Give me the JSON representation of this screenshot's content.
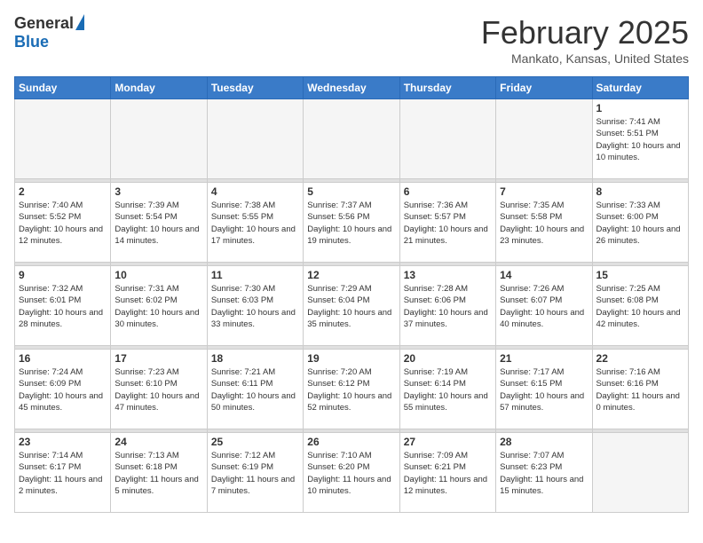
{
  "header": {
    "logo_general": "General",
    "logo_blue": "Blue",
    "month_title": "February 2025",
    "location": "Mankato, Kansas, United States"
  },
  "days_of_week": [
    "Sunday",
    "Monday",
    "Tuesday",
    "Wednesday",
    "Thursday",
    "Friday",
    "Saturday"
  ],
  "weeks": [
    [
      {
        "day": "",
        "empty": true
      },
      {
        "day": "",
        "empty": true
      },
      {
        "day": "",
        "empty": true
      },
      {
        "day": "",
        "empty": true
      },
      {
        "day": "",
        "empty": true
      },
      {
        "day": "",
        "empty": true
      },
      {
        "day": "1",
        "sunrise": "Sunrise: 7:41 AM",
        "sunset": "Sunset: 5:51 PM",
        "daylight": "Daylight: 10 hours and 10 minutes."
      }
    ],
    [
      {
        "day": "2",
        "sunrise": "Sunrise: 7:40 AM",
        "sunset": "Sunset: 5:52 PM",
        "daylight": "Daylight: 10 hours and 12 minutes."
      },
      {
        "day": "3",
        "sunrise": "Sunrise: 7:39 AM",
        "sunset": "Sunset: 5:54 PM",
        "daylight": "Daylight: 10 hours and 14 minutes."
      },
      {
        "day": "4",
        "sunrise": "Sunrise: 7:38 AM",
        "sunset": "Sunset: 5:55 PM",
        "daylight": "Daylight: 10 hours and 17 minutes."
      },
      {
        "day": "5",
        "sunrise": "Sunrise: 7:37 AM",
        "sunset": "Sunset: 5:56 PM",
        "daylight": "Daylight: 10 hours and 19 minutes."
      },
      {
        "day": "6",
        "sunrise": "Sunrise: 7:36 AM",
        "sunset": "Sunset: 5:57 PM",
        "daylight": "Daylight: 10 hours and 21 minutes."
      },
      {
        "day": "7",
        "sunrise": "Sunrise: 7:35 AM",
        "sunset": "Sunset: 5:58 PM",
        "daylight": "Daylight: 10 hours and 23 minutes."
      },
      {
        "day": "8",
        "sunrise": "Sunrise: 7:33 AM",
        "sunset": "Sunset: 6:00 PM",
        "daylight": "Daylight: 10 hours and 26 minutes."
      }
    ],
    [
      {
        "day": "9",
        "sunrise": "Sunrise: 7:32 AM",
        "sunset": "Sunset: 6:01 PM",
        "daylight": "Daylight: 10 hours and 28 minutes."
      },
      {
        "day": "10",
        "sunrise": "Sunrise: 7:31 AM",
        "sunset": "Sunset: 6:02 PM",
        "daylight": "Daylight: 10 hours and 30 minutes."
      },
      {
        "day": "11",
        "sunrise": "Sunrise: 7:30 AM",
        "sunset": "Sunset: 6:03 PM",
        "daylight": "Daylight: 10 hours and 33 minutes."
      },
      {
        "day": "12",
        "sunrise": "Sunrise: 7:29 AM",
        "sunset": "Sunset: 6:04 PM",
        "daylight": "Daylight: 10 hours and 35 minutes."
      },
      {
        "day": "13",
        "sunrise": "Sunrise: 7:28 AM",
        "sunset": "Sunset: 6:06 PM",
        "daylight": "Daylight: 10 hours and 37 minutes."
      },
      {
        "day": "14",
        "sunrise": "Sunrise: 7:26 AM",
        "sunset": "Sunset: 6:07 PM",
        "daylight": "Daylight: 10 hours and 40 minutes."
      },
      {
        "day": "15",
        "sunrise": "Sunrise: 7:25 AM",
        "sunset": "Sunset: 6:08 PM",
        "daylight": "Daylight: 10 hours and 42 minutes."
      }
    ],
    [
      {
        "day": "16",
        "sunrise": "Sunrise: 7:24 AM",
        "sunset": "Sunset: 6:09 PM",
        "daylight": "Daylight: 10 hours and 45 minutes."
      },
      {
        "day": "17",
        "sunrise": "Sunrise: 7:23 AM",
        "sunset": "Sunset: 6:10 PM",
        "daylight": "Daylight: 10 hours and 47 minutes."
      },
      {
        "day": "18",
        "sunrise": "Sunrise: 7:21 AM",
        "sunset": "Sunset: 6:11 PM",
        "daylight": "Daylight: 10 hours and 50 minutes."
      },
      {
        "day": "19",
        "sunrise": "Sunrise: 7:20 AM",
        "sunset": "Sunset: 6:12 PM",
        "daylight": "Daylight: 10 hours and 52 minutes."
      },
      {
        "day": "20",
        "sunrise": "Sunrise: 7:19 AM",
        "sunset": "Sunset: 6:14 PM",
        "daylight": "Daylight: 10 hours and 55 minutes."
      },
      {
        "day": "21",
        "sunrise": "Sunrise: 7:17 AM",
        "sunset": "Sunset: 6:15 PM",
        "daylight": "Daylight: 10 hours and 57 minutes."
      },
      {
        "day": "22",
        "sunrise": "Sunrise: 7:16 AM",
        "sunset": "Sunset: 6:16 PM",
        "daylight": "Daylight: 11 hours and 0 minutes."
      }
    ],
    [
      {
        "day": "23",
        "sunrise": "Sunrise: 7:14 AM",
        "sunset": "Sunset: 6:17 PM",
        "daylight": "Daylight: 11 hours and 2 minutes."
      },
      {
        "day": "24",
        "sunrise": "Sunrise: 7:13 AM",
        "sunset": "Sunset: 6:18 PM",
        "daylight": "Daylight: 11 hours and 5 minutes."
      },
      {
        "day": "25",
        "sunrise": "Sunrise: 7:12 AM",
        "sunset": "Sunset: 6:19 PM",
        "daylight": "Daylight: 11 hours and 7 minutes."
      },
      {
        "day": "26",
        "sunrise": "Sunrise: 7:10 AM",
        "sunset": "Sunset: 6:20 PM",
        "daylight": "Daylight: 11 hours and 10 minutes."
      },
      {
        "day": "27",
        "sunrise": "Sunrise: 7:09 AM",
        "sunset": "Sunset: 6:21 PM",
        "daylight": "Daylight: 11 hours and 12 minutes."
      },
      {
        "day": "28",
        "sunrise": "Sunrise: 7:07 AM",
        "sunset": "Sunset: 6:23 PM",
        "daylight": "Daylight: 11 hours and 15 minutes."
      },
      {
        "day": "",
        "empty": true
      }
    ]
  ]
}
